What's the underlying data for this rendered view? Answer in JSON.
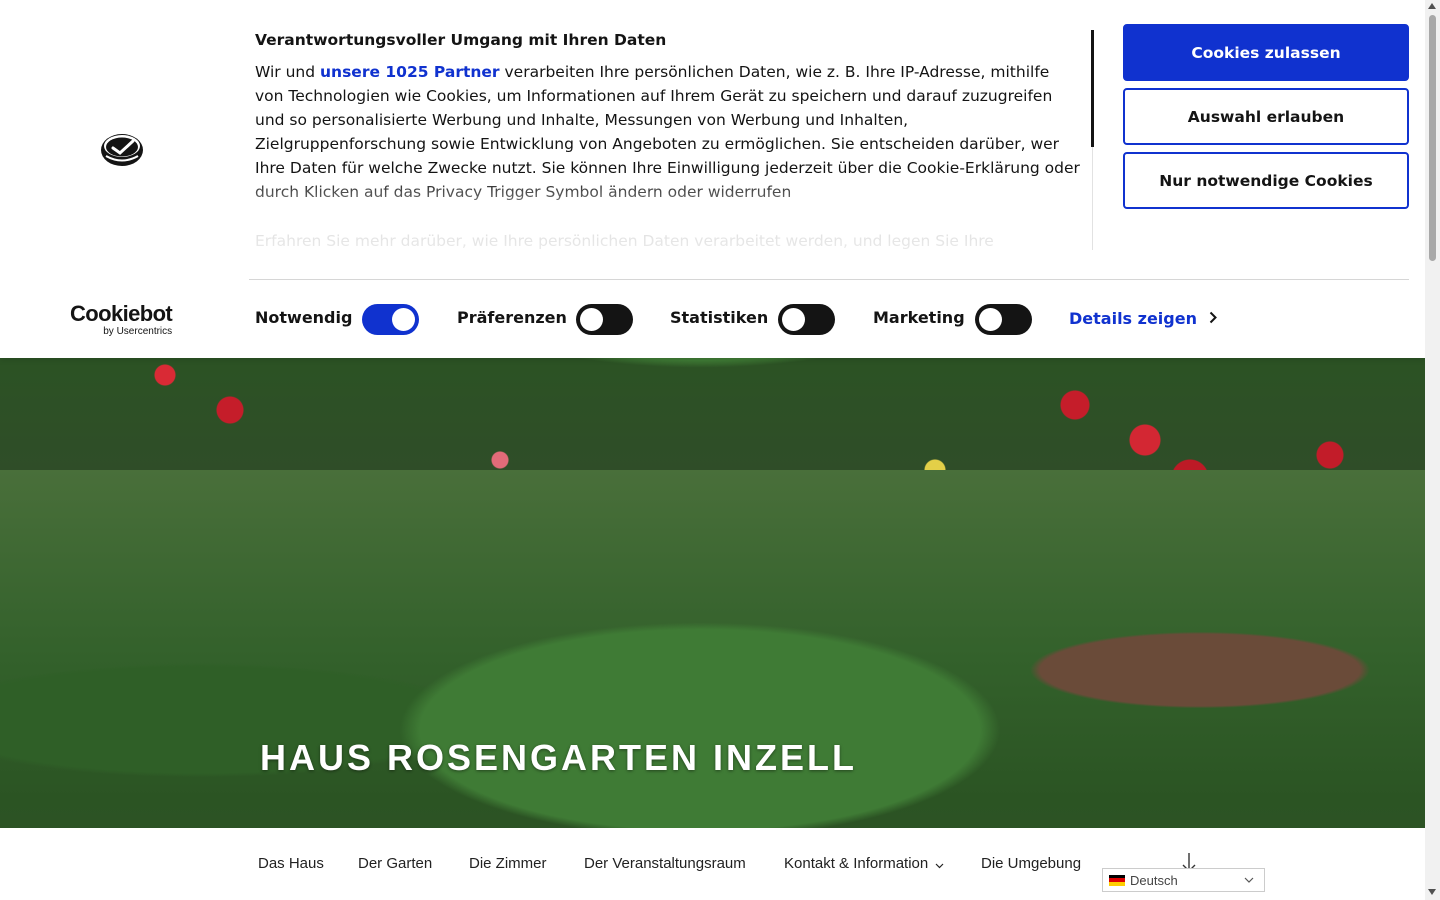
{
  "site": {
    "title": "HAUS ROSENGARTEN INZELL"
  },
  "cookie_banner": {
    "heading": "Verantwortungsvoller Umgang mit Ihren Daten",
    "body_prefix": "Wir und ",
    "partners_link": "unsere 1025 Partner",
    "body_suffix": " verarbeiten Ihre persönlichen Daten, wie z. B. Ihre IP-Adresse, mithilfe von Technologien wie Cookies, um Informationen auf Ihrem Gerät zu speichern und darauf zuzugreifen und so personalisierte Werbung und Inhalte, Messungen von Werbung und Inhalten, Zielgruppenforschung sowie Entwicklung von Angeboten zu ermöglichen. Sie entscheiden darüber, wer Ihre Daten für welche Zwecke nutzt. Sie können Ihre Einwilligung jederzeit über die Cookie-Erklärung oder durch Klicken auf das Privacy Trigger Symbol ändern oder widerrufen",
    "body_more": "Erfahren Sie mehr darüber, wie Ihre persönlichen Daten verarbeitet werden, und legen Sie Ihre",
    "buttons": {
      "allow_all": "Cookies zulassen",
      "allow_selection": "Auswahl erlauben",
      "necessary_only": "Nur notwendige Cookies"
    },
    "brand": {
      "name": "Cookiebot",
      "by": "by Usercentrics"
    },
    "toggles": [
      {
        "label": "Notwendig",
        "state": "on"
      },
      {
        "label": "Präferenzen",
        "state": "off"
      },
      {
        "label": "Statistiken",
        "state": "off"
      },
      {
        "label": "Marketing",
        "state": "off"
      }
    ],
    "details_link": "Details zeigen",
    "accent_color": "#1032cf"
  },
  "nav": {
    "items": [
      "Das Haus",
      "Der Garten",
      "Die Zimmer",
      "Der Veranstaltungsraum",
      "Kontakt & Information",
      "Die Umgebung"
    ],
    "language": {
      "selected": "Deutsch"
    }
  },
  "icons": {
    "privacy": "privacy-trigger-icon",
    "details_chevron": "chevron-right-icon",
    "dropdown": "chevron-down-icon",
    "scroll_down": "arrow-down-icon",
    "flag": "german-flag-icon"
  }
}
